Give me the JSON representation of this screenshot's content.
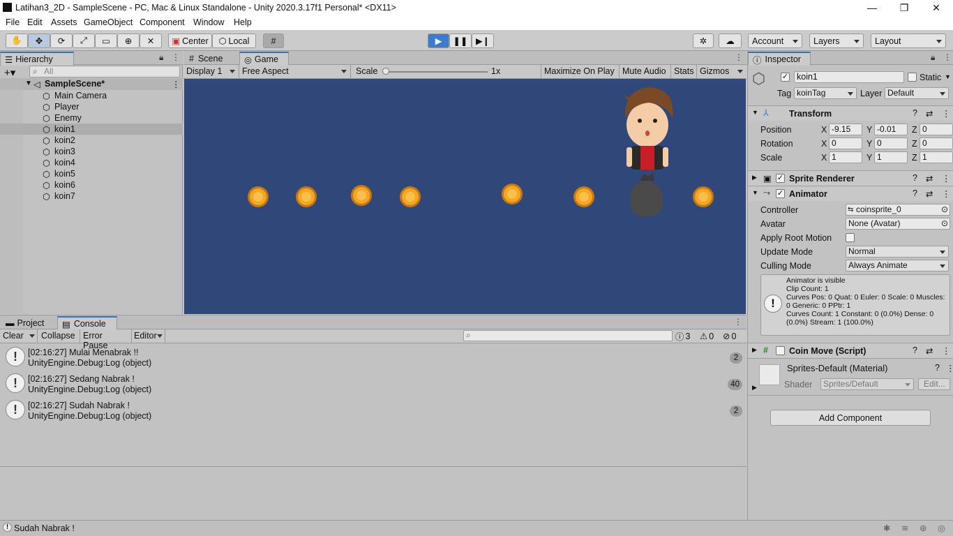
{
  "window": {
    "title": "Latihan3_2D - SampleScene - PC, Mac & Linux Standalone - Unity 2020.3.17f1 Personal* <DX11>",
    "minimize": "—",
    "maximize": "❐",
    "close": "✕"
  },
  "menu": [
    "File",
    "Edit",
    "Assets",
    "GameObject",
    "Component",
    "Window",
    "Help"
  ],
  "toolbar": {
    "pivot": "Center",
    "space": "Local",
    "account": "Account",
    "layers": "Layers",
    "layout": "Layout",
    "play_active": true
  },
  "hierarchy": {
    "tab": "Hierarchy",
    "search_placeholder": "All",
    "scene": "SampleScene*",
    "items": [
      "Main Camera",
      "Player",
      "Enemy",
      "koin1",
      "koin2",
      "koin3",
      "koin4",
      "koin5",
      "koin6",
      "koin7"
    ],
    "selected": "koin1"
  },
  "game": {
    "tabs": [
      "Scene",
      "Game"
    ],
    "active_tab": "Game",
    "display": "Display 1",
    "aspect": "Free Aspect",
    "scale_label": "Scale",
    "scale_value": "1x",
    "maximize": "Maximize On Play",
    "mute": "Mute Audio",
    "stats": "Stats",
    "gizmos": "Gizmos",
    "background": "#30477a",
    "coin_count": 7
  },
  "console": {
    "tabs": [
      "Project",
      "Console"
    ],
    "active_tab": "Console",
    "clear": "Clear",
    "collapse": "Collapse",
    "error_pause": "Error Pause",
    "editor": "Editor",
    "counts": {
      "log": "3",
      "warn": "0",
      "error": "0"
    },
    "logs": [
      {
        "line1": "[02:16:27] Mulai Menabrak !!",
        "line2": "UnityEngine.Debug:Log (object)",
        "count": "2"
      },
      {
        "line1": "[02:16:27] Sedang Nabrak !",
        "line2": "UnityEngine.Debug:Log (object)",
        "count": "40"
      },
      {
        "line1": "[02:16:27] Sudah Nabrak !",
        "line2": "UnityEngine.Debug:Log (object)",
        "count": "2"
      }
    ]
  },
  "inspector": {
    "tab": "Inspector",
    "object_name": "koin1",
    "static": "Static",
    "tag_label": "Tag",
    "tag": "koinTag",
    "layer_label": "Layer",
    "layer": "Default",
    "transform": {
      "title": "Transform",
      "position_label": "Position",
      "rotation_label": "Rotation",
      "scale_label": "Scale",
      "position": {
        "x": "-9.15",
        "y": "-0.01",
        "z": "0"
      },
      "rotation": {
        "x": "0",
        "y": "0",
        "z": "0"
      },
      "scale": {
        "x": "1",
        "y": "1",
        "z": "1"
      }
    },
    "sprite_renderer": "Sprite Renderer",
    "animator": {
      "title": "Animator",
      "controller_label": "Controller",
      "controller": "coinsprite_0",
      "avatar_label": "Avatar",
      "avatar": "None (Avatar)",
      "root_motion_label": "Apply Root Motion",
      "update_mode_label": "Update Mode",
      "update_mode": "Normal",
      "culling_label": "Culling Mode",
      "culling": "Always Animate",
      "info": [
        "Animator is visible",
        "Clip Count: 1",
        "Curves Pos: 0 Quat: 0 Euler: 0 Scale: 0 Muscles:",
        "0 Generic: 0 PPtr: 1",
        "Curves Count: 1 Constant: 0 (0.0%) Dense: 0",
        "(0.0%) Stream: 1 (100.0%)"
      ]
    },
    "coin_move": "Coin Move (Script)",
    "material": "Sprites-Default (Material)",
    "shader_label": "Shader",
    "shader": "Sprites/Default",
    "edit": "Edit...",
    "add_component": "Add Component"
  },
  "status": {
    "message": "Sudah Nabrak !"
  }
}
